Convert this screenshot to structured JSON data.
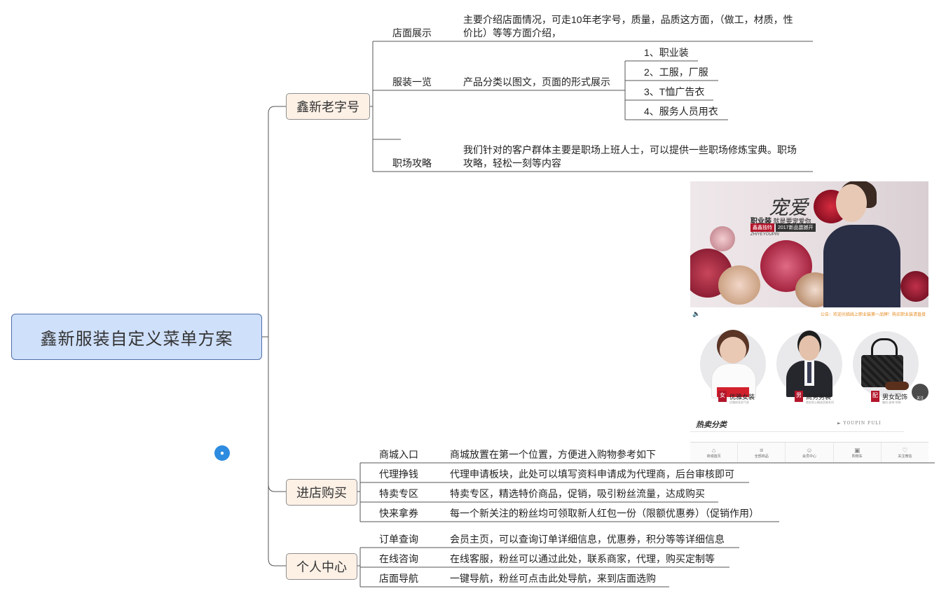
{
  "root": {
    "label": "鑫新服装自定义菜单方案"
  },
  "branches": [
    {
      "label": "鑫新老字号",
      "items": [
        {
          "label": "店面展示",
          "desc": "主要介绍店面情况，可走10年老字号，质量，品质这方面，（做工，材质，性价比）等等方面介绍，",
          "desc_lines": [
            "主要介绍店面情况，可走10年老字号，质量，品质这方面，（做工，材质，性",
            "价比）等等方面介绍，"
          ]
        },
        {
          "label": "服装一览",
          "desc": "产品分类以图文，页面的形式展示",
          "subitems": [
            "1、职业装",
            "2、工服，厂服",
            "3、T恤广告衣",
            "4、服务人员用衣"
          ]
        },
        {
          "label": "职场攻略",
          "desc": "我们针对的客户群体主要是职场上班人士，可以提供一些职场修炼宝典。职场攻略，轻松一刻等内容",
          "desc_lines": [
            "我们针对的客户群体主要是职场上班人士，可以提供一些职场修炼宝典。职场",
            "攻略，轻松一刻等内容"
          ]
        }
      ]
    },
    {
      "label": "进店购买",
      "items": [
        {
          "label": "商城入口",
          "desc": "商城放置在第一个位置，方便进入购物参考如下"
        },
        {
          "label": "代理挣钱",
          "desc": "代理申请板块，此处可以填写资料申请成为代理商，后台审核即可"
        },
        {
          "label": "特卖专区",
          "desc": "特卖专区，精选特价商品，促销，吸引粉丝流量，达成购买"
        },
        {
          "label": "快来拿券",
          "desc": "每一个新关注的粉丝均可领取新人红包一份（限额优惠券）（促销作用）"
        }
      ]
    },
    {
      "label": "个人中心",
      "items": [
        {
          "label": "订单查询",
          "desc": "会员主页，可以查询订单详细信息，优惠券，积分等等详细信息"
        },
        {
          "label": "在线咨询",
          "desc": "在线客服，粉丝可以通过此处，联系商家，代理，购买定制等"
        },
        {
          "label": "店面导航",
          "desc": "一键导航，粉丝可点击此处导航，来到店面选购"
        }
      ]
    }
  ],
  "preview": {
    "hero_title": "宠爱",
    "hero_sub_bold": "职业装",
    "hero_sub": "就是要宠爱你",
    "hero_tags": [
      "鑫鑫独特",
      "2017新品震撼开"
    ],
    "hero_brand": "ZHIYEYOUPIN",
    "notice": "公告：欢迎光临线上职业装第一品牌！购买职业装请直接",
    "categories": [
      {
        "ribbon": "女",
        "label": "优雅女装",
        "sub": "优雅修身显气质"
      },
      {
        "ribbon": "男",
        "label": "商务男装",
        "sub": "商务男士精选西装系列"
      },
      {
        "ribbon": "配",
        "label": "男女配饰",
        "sub": "箱包·皮带·领带"
      }
    ],
    "follow": "关注",
    "hot_title": "热卖分类",
    "hot_en": "YOUPIN FULI",
    "tabs": [
      {
        "icon": "home-icon",
        "label": "商城首页"
      },
      {
        "icon": "list-icon",
        "label": "全部商品"
      },
      {
        "icon": "user-icon",
        "label": "会员中心"
      },
      {
        "icon": "cart-icon",
        "label": "购物车"
      },
      {
        "icon": "follow-icon",
        "label": "关注微信"
      }
    ],
    "colors": {
      "tag_red": "#b3162b",
      "tag_dark": "#333333",
      "notice": "#e58a1f",
      "chat": "#2d8be0"
    }
  }
}
